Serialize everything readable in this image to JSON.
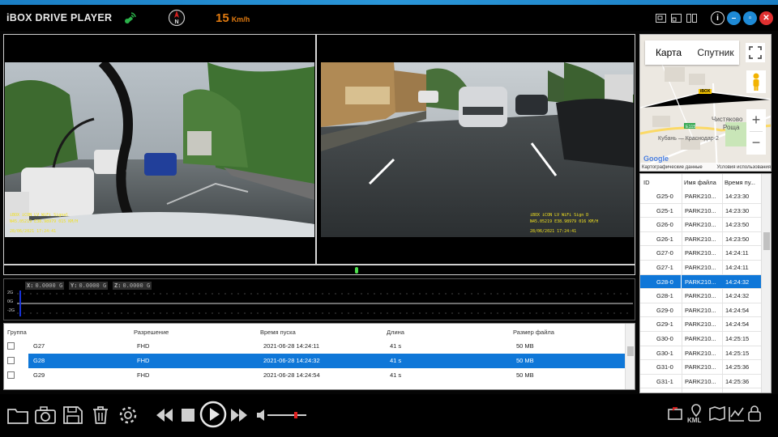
{
  "app": {
    "title": "iBOX DRIVE PLAYER",
    "speed_value": "15",
    "speed_unit": "Km/h",
    "compass_letter": "N"
  },
  "colors": {
    "accent": "#0f77d8",
    "speed": "#e07a10",
    "close": "#e03030",
    "window_buttons": "#1e8ad6",
    "seek_knob": "#4ee04e"
  },
  "video": {
    "front_overlay": [
      "iBOX iCON LV WiFi Signal",
      "N45.05219   E38.98979    015 KM/H",
      "28/06/2021 17:24:41"
    ],
    "rear_overlay": [
      "iBOX iCON LV WiFi Sign D",
      "N45.05219   E38.98979    016 KM/H",
      "28/06/2021 17:24:41"
    ]
  },
  "playback": {
    "progress_fraction": 0.56,
    "volume_fraction": 0.72
  },
  "gsensor": {
    "readouts": [
      {
        "axis": "X:",
        "value": "0.0000 G"
      },
      {
        "axis": "Y:",
        "value": "0.0000 G"
      },
      {
        "axis": "Z:",
        "value": "0.0000 G"
      }
    ],
    "scale": [
      "2G",
      "0G",
      "-2G"
    ]
  },
  "file_table": {
    "headers": [
      "Группа",
      "Разрешение",
      "Время пуска",
      "Длина",
      "Размер файла"
    ],
    "rows": [
      {
        "group": "G27",
        "resolution": "FHD",
        "start": "2021-06-28 14:24:11",
        "length": "41 s",
        "size": "50 MB",
        "selected": false
      },
      {
        "group": "G28",
        "resolution": "FHD",
        "start": "2021-06-28 14:24:32",
        "length": "41 s",
        "size": "50 MB",
        "selected": true
      },
      {
        "group": "G29",
        "resolution": "FHD",
        "start": "2021-06-28 14:24:54",
        "length": "41 s",
        "size": "50 MB",
        "selected": false
      }
    ]
  },
  "map": {
    "tab_map": "Карта",
    "tab_satellite": "Спутник",
    "zoom_in": "+",
    "zoom_out": "−",
    "place_1": "Чистяково",
    "place_2": "Роща",
    "road": "Е115",
    "road_label": "Кубань — Краснодар-2",
    "marker": "iBOX",
    "footer_left": "Картографические данные",
    "footer_right": "Условия использования",
    "logo": "Google"
  },
  "id_list": {
    "headers": [
      "ID",
      "Имя файла",
      "Время пу..."
    ],
    "rows": [
      {
        "id": "G25-0",
        "name": "PARK210...",
        "time": "14:23:30",
        "selected": false
      },
      {
        "id": "G25-1",
        "name": "PARK210...",
        "time": "14:23:30",
        "selected": false
      },
      {
        "id": "G26-0",
        "name": "PARK210...",
        "time": "14:23:50",
        "selected": false
      },
      {
        "id": "G26-1",
        "name": "PARK210...",
        "time": "14:23:50",
        "selected": false
      },
      {
        "id": "G27-0",
        "name": "PARK210...",
        "time": "14:24:11",
        "selected": false
      },
      {
        "id": "G27-1",
        "name": "PARK210...",
        "time": "14:24:11",
        "selected": false
      },
      {
        "id": "G28-0",
        "name": "PARK210...",
        "time": "14:24:32",
        "selected": true
      },
      {
        "id": "G28-1",
        "name": "PARK210...",
        "time": "14:24:32",
        "selected": false
      },
      {
        "id": "G29-0",
        "name": "PARK210...",
        "time": "14:24:54",
        "selected": false
      },
      {
        "id": "G29-1",
        "name": "PARK210...",
        "time": "14:24:54",
        "selected": false
      },
      {
        "id": "G30-0",
        "name": "PARK210...",
        "time": "14:25:15",
        "selected": false
      },
      {
        "id": "G30-1",
        "name": "PARK210...",
        "time": "14:25:15",
        "selected": false
      },
      {
        "id": "G31-0",
        "name": "PARK210...",
        "time": "14:25:36",
        "selected": false
      },
      {
        "id": "G31-1",
        "name": "PARK210...",
        "time": "14:25:36",
        "selected": false
      }
    ]
  },
  "controls": {
    "kml_label": "KML",
    "icons": [
      "open-folder-icon",
      "snapshot-icon",
      "save-icon",
      "delete-icon",
      "settings-icon",
      "previous-icon",
      "stop-icon",
      "play-icon",
      "next-icon",
      "volume-icon",
      "export-icon",
      "kml-icon",
      "map-icon",
      "chart-icon",
      "lock-icon"
    ]
  }
}
